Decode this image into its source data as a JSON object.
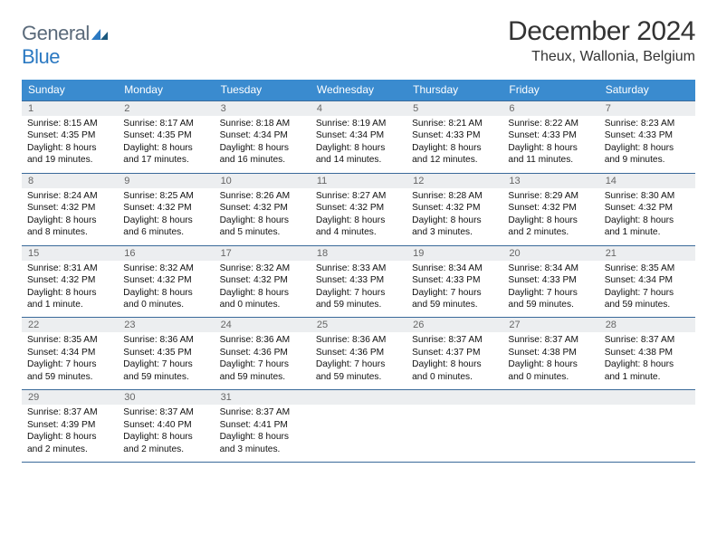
{
  "logo": {
    "word1": "General",
    "word2": "Blue"
  },
  "title": "December 2024",
  "location": "Theux, Wallonia, Belgium",
  "weekdays": [
    "Sunday",
    "Monday",
    "Tuesday",
    "Wednesday",
    "Thursday",
    "Friday",
    "Saturday"
  ],
  "weeks": [
    {
      "nums": [
        "1",
        "2",
        "3",
        "4",
        "5",
        "6",
        "7"
      ],
      "days": [
        {
          "sunrise": "Sunrise: 8:15 AM",
          "sunset": "Sunset: 4:35 PM",
          "dl1": "Daylight: 8 hours",
          "dl2": "and 19 minutes."
        },
        {
          "sunrise": "Sunrise: 8:17 AM",
          "sunset": "Sunset: 4:35 PM",
          "dl1": "Daylight: 8 hours",
          "dl2": "and 17 minutes."
        },
        {
          "sunrise": "Sunrise: 8:18 AM",
          "sunset": "Sunset: 4:34 PM",
          "dl1": "Daylight: 8 hours",
          "dl2": "and 16 minutes."
        },
        {
          "sunrise": "Sunrise: 8:19 AM",
          "sunset": "Sunset: 4:34 PM",
          "dl1": "Daylight: 8 hours",
          "dl2": "and 14 minutes."
        },
        {
          "sunrise": "Sunrise: 8:21 AM",
          "sunset": "Sunset: 4:33 PM",
          "dl1": "Daylight: 8 hours",
          "dl2": "and 12 minutes."
        },
        {
          "sunrise": "Sunrise: 8:22 AM",
          "sunset": "Sunset: 4:33 PM",
          "dl1": "Daylight: 8 hours",
          "dl2": "and 11 minutes."
        },
        {
          "sunrise": "Sunrise: 8:23 AM",
          "sunset": "Sunset: 4:33 PM",
          "dl1": "Daylight: 8 hours",
          "dl2": "and 9 minutes."
        }
      ]
    },
    {
      "nums": [
        "8",
        "9",
        "10",
        "11",
        "12",
        "13",
        "14"
      ],
      "days": [
        {
          "sunrise": "Sunrise: 8:24 AM",
          "sunset": "Sunset: 4:32 PM",
          "dl1": "Daylight: 8 hours",
          "dl2": "and 8 minutes."
        },
        {
          "sunrise": "Sunrise: 8:25 AM",
          "sunset": "Sunset: 4:32 PM",
          "dl1": "Daylight: 8 hours",
          "dl2": "and 6 minutes."
        },
        {
          "sunrise": "Sunrise: 8:26 AM",
          "sunset": "Sunset: 4:32 PM",
          "dl1": "Daylight: 8 hours",
          "dl2": "and 5 minutes."
        },
        {
          "sunrise": "Sunrise: 8:27 AM",
          "sunset": "Sunset: 4:32 PM",
          "dl1": "Daylight: 8 hours",
          "dl2": "and 4 minutes."
        },
        {
          "sunrise": "Sunrise: 8:28 AM",
          "sunset": "Sunset: 4:32 PM",
          "dl1": "Daylight: 8 hours",
          "dl2": "and 3 minutes."
        },
        {
          "sunrise": "Sunrise: 8:29 AM",
          "sunset": "Sunset: 4:32 PM",
          "dl1": "Daylight: 8 hours",
          "dl2": "and 2 minutes."
        },
        {
          "sunrise": "Sunrise: 8:30 AM",
          "sunset": "Sunset: 4:32 PM",
          "dl1": "Daylight: 8 hours",
          "dl2": "and 1 minute."
        }
      ]
    },
    {
      "nums": [
        "15",
        "16",
        "17",
        "18",
        "19",
        "20",
        "21"
      ],
      "days": [
        {
          "sunrise": "Sunrise: 8:31 AM",
          "sunset": "Sunset: 4:32 PM",
          "dl1": "Daylight: 8 hours",
          "dl2": "and 1 minute."
        },
        {
          "sunrise": "Sunrise: 8:32 AM",
          "sunset": "Sunset: 4:32 PM",
          "dl1": "Daylight: 8 hours",
          "dl2": "and 0 minutes."
        },
        {
          "sunrise": "Sunrise: 8:32 AM",
          "sunset": "Sunset: 4:32 PM",
          "dl1": "Daylight: 8 hours",
          "dl2": "and 0 minutes."
        },
        {
          "sunrise": "Sunrise: 8:33 AM",
          "sunset": "Sunset: 4:33 PM",
          "dl1": "Daylight: 7 hours",
          "dl2": "and 59 minutes."
        },
        {
          "sunrise": "Sunrise: 8:34 AM",
          "sunset": "Sunset: 4:33 PM",
          "dl1": "Daylight: 7 hours",
          "dl2": "and 59 minutes."
        },
        {
          "sunrise": "Sunrise: 8:34 AM",
          "sunset": "Sunset: 4:33 PM",
          "dl1": "Daylight: 7 hours",
          "dl2": "and 59 minutes."
        },
        {
          "sunrise": "Sunrise: 8:35 AM",
          "sunset": "Sunset: 4:34 PM",
          "dl1": "Daylight: 7 hours",
          "dl2": "and 59 minutes."
        }
      ]
    },
    {
      "nums": [
        "22",
        "23",
        "24",
        "25",
        "26",
        "27",
        "28"
      ],
      "days": [
        {
          "sunrise": "Sunrise: 8:35 AM",
          "sunset": "Sunset: 4:34 PM",
          "dl1": "Daylight: 7 hours",
          "dl2": "and 59 minutes."
        },
        {
          "sunrise": "Sunrise: 8:36 AM",
          "sunset": "Sunset: 4:35 PM",
          "dl1": "Daylight: 7 hours",
          "dl2": "and 59 minutes."
        },
        {
          "sunrise": "Sunrise: 8:36 AM",
          "sunset": "Sunset: 4:36 PM",
          "dl1": "Daylight: 7 hours",
          "dl2": "and 59 minutes."
        },
        {
          "sunrise": "Sunrise: 8:36 AM",
          "sunset": "Sunset: 4:36 PM",
          "dl1": "Daylight: 7 hours",
          "dl2": "and 59 minutes."
        },
        {
          "sunrise": "Sunrise: 8:37 AM",
          "sunset": "Sunset: 4:37 PM",
          "dl1": "Daylight: 8 hours",
          "dl2": "and 0 minutes."
        },
        {
          "sunrise": "Sunrise: 8:37 AM",
          "sunset": "Sunset: 4:38 PM",
          "dl1": "Daylight: 8 hours",
          "dl2": "and 0 minutes."
        },
        {
          "sunrise": "Sunrise: 8:37 AM",
          "sunset": "Sunset: 4:38 PM",
          "dl1": "Daylight: 8 hours",
          "dl2": "and 1 minute."
        }
      ]
    },
    {
      "nums": [
        "29",
        "30",
        "31",
        "",
        "",
        "",
        ""
      ],
      "days": [
        {
          "sunrise": "Sunrise: 8:37 AM",
          "sunset": "Sunset: 4:39 PM",
          "dl1": "Daylight: 8 hours",
          "dl2": "and 2 minutes."
        },
        {
          "sunrise": "Sunrise: 8:37 AM",
          "sunset": "Sunset: 4:40 PM",
          "dl1": "Daylight: 8 hours",
          "dl2": "and 2 minutes."
        },
        {
          "sunrise": "Sunrise: 8:37 AM",
          "sunset": "Sunset: 4:41 PM",
          "dl1": "Daylight: 8 hours",
          "dl2": "and 3 minutes."
        },
        {
          "sunrise": "",
          "sunset": "",
          "dl1": "",
          "dl2": ""
        },
        {
          "sunrise": "",
          "sunset": "",
          "dl1": "",
          "dl2": ""
        },
        {
          "sunrise": "",
          "sunset": "",
          "dl1": "",
          "dl2": ""
        },
        {
          "sunrise": "",
          "sunset": "",
          "dl1": "",
          "dl2": ""
        }
      ]
    }
  ]
}
